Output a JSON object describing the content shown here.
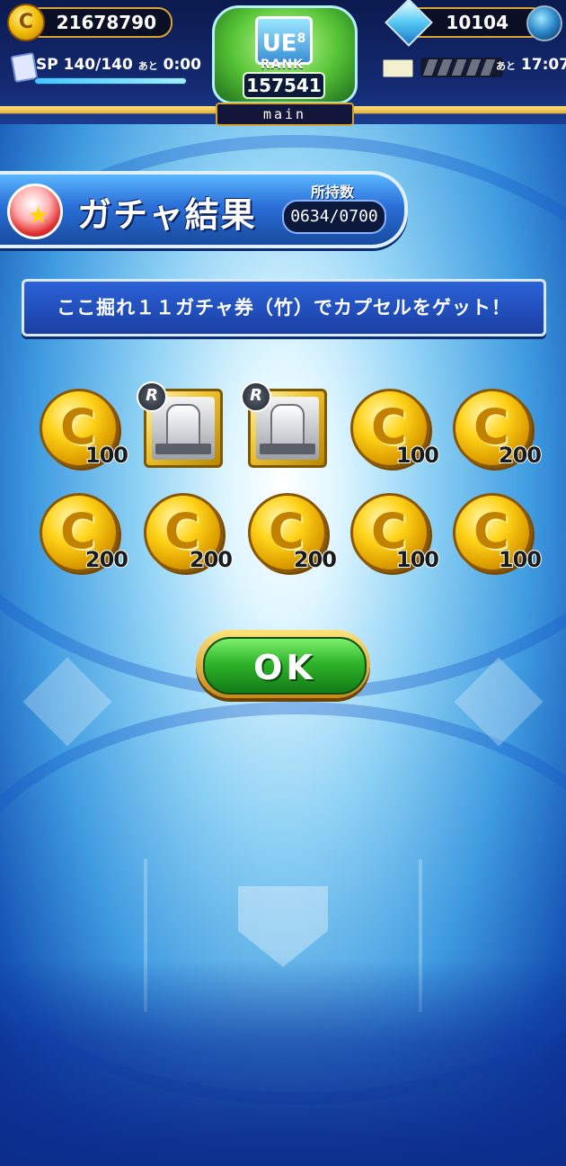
{
  "status_bar": {
    "coins": "21678790",
    "gems": "10104",
    "sp_label": "SP",
    "sp_value": "140/140",
    "sp_remaining_prefix": "あと",
    "sp_timer": "0:00",
    "sp_fill_fraction": 1.0,
    "stamina_remaining_prefix": "あと",
    "stamina_timer": "17:07",
    "rank_shield_text": "UE",
    "rank_shield_sup": "8",
    "rank_label": "RANK",
    "rank_value": "157541",
    "server_tab": "main"
  },
  "header": {
    "title": "ガチャ結果",
    "owned_label": "所持数",
    "owned_value": "0634/0700"
  },
  "message": "ここ掘れ１１ガチャ券（竹）でカプセルをゲット！",
  "rewards": [
    {
      "kind": "coin",
      "amount": "100"
    },
    {
      "kind": "item",
      "rarity": "R"
    },
    {
      "kind": "item",
      "rarity": "R"
    },
    {
      "kind": "coin",
      "amount": "100"
    },
    {
      "kind": "coin",
      "amount": "200"
    },
    {
      "kind": "coin",
      "amount": "200"
    },
    {
      "kind": "coin",
      "amount": "200"
    },
    {
      "kind": "coin",
      "amount": "200"
    },
    {
      "kind": "coin",
      "amount": "100"
    },
    {
      "kind": "coin",
      "amount": "100"
    }
  ],
  "ok_button": "OK",
  "icons": {
    "coin": "coin-icon",
    "gem": "diamond-icon",
    "orb": "orb-icon",
    "capsule": "capsule-icon",
    "ticket": "ticket-icon"
  },
  "colors": {
    "accent_gold": "#d9a531",
    "header_blue": "#2a6fd8",
    "ok_green": "#2fb52a"
  }
}
